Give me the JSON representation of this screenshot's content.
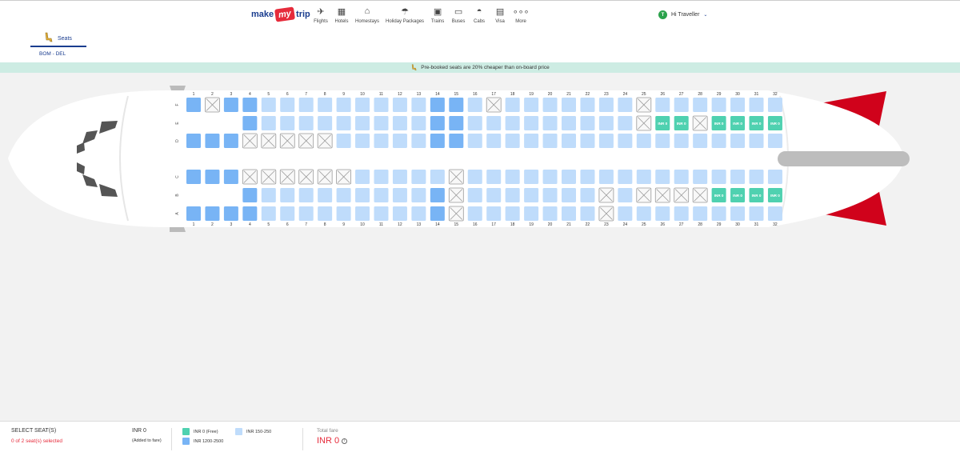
{
  "header": {
    "logo": {
      "make": "make",
      "my": "my",
      "trip": "trip"
    },
    "nav": [
      {
        "label": "Flights",
        "icon": "plane-icon",
        "glyph": "✈"
      },
      {
        "label": "Hotels",
        "icon": "hotel-icon",
        "glyph": "▦"
      },
      {
        "label": "Homestays",
        "icon": "homestay-icon",
        "glyph": "⌂"
      },
      {
        "label": "Holiday Packages",
        "icon": "holiday-icon",
        "glyph": "☂"
      },
      {
        "label": "Trains",
        "icon": "train-icon",
        "glyph": "▣"
      },
      {
        "label": "Buses",
        "icon": "bus-icon",
        "glyph": "▭"
      },
      {
        "label": "Cabs",
        "icon": "cab-icon",
        "glyph": "◓"
      },
      {
        "label": "Visa",
        "icon": "visa-icon",
        "glyph": "▤"
      },
      {
        "label": "More",
        "icon": "more-icon",
        "glyph": "∘∘∘"
      }
    ],
    "user": {
      "initial": "T",
      "greeting": "Hi Traveller"
    }
  },
  "tabs": {
    "seats_label": "Seats"
  },
  "route": "BOM - DEL",
  "promo": "Pre-booked seats are 20% cheaper than on-board price",
  "colors": {
    "free": "#4fd1b0",
    "cheap": "#bfdcfb",
    "premium": "#78b4f5",
    "accent": "#e62b3b",
    "brand": "#1a3d8f",
    "tail": "#d0021b"
  },
  "seatmap": {
    "columns": [
      "1",
      "2",
      "3",
      "4",
      "5",
      "6",
      "7",
      "8",
      "9",
      "10",
      "11",
      "12",
      "13",
      "14",
      "15",
      "16",
      "17",
      "18",
      "19",
      "20",
      "21",
      "22",
      "23",
      "24",
      "25",
      "26",
      "27",
      "28",
      "29",
      "30",
      "31",
      "32"
    ],
    "free_label": "INR 0",
    "rows": [
      {
        "letter": "F",
        "seats": "PXPPCCCCCCCCCPPCXCCCCCCCXCCCCCCC"
      },
      {
        "letter": "E",
        "seats": "---PCCCCCCCCCPPCCCCCCCCCXFFXFFFF"
      },
      {
        "letter": "D",
        "seats": "PPPXXXXXCCCCCPPCCCCCCCCCCCCCCCCC"
      },
      {
        "letter": "C",
        "seats": "PPPXXXXXXCCCCCXCCCCCCCCCCCCCCCCC"
      },
      {
        "letter": "B",
        "seats": "---PCCCCCCCCCPXCCCCCCCXCXXXXFFFF"
      },
      {
        "letter": "A",
        "seats": "PPPPCCCCCCCCCPXCCCCCCCXCCCCCCCCC"
      }
    ]
  },
  "footer": {
    "select_title": "SELECT SEAT(S)",
    "selected_count": "0 of 2 seat(s) selected",
    "added_amount": "INR 0",
    "added_note": "(Added to fare)",
    "legend": [
      {
        "label": "INR 0 (Free)",
        "color": "#4fd1b0"
      },
      {
        "label": "INR 150-250",
        "color": "#bfdcfb"
      },
      {
        "label": "INR 1200-2500",
        "color": "#78b4f5"
      }
    ],
    "total_label": "Total fare",
    "total_value": "INR 0"
  }
}
